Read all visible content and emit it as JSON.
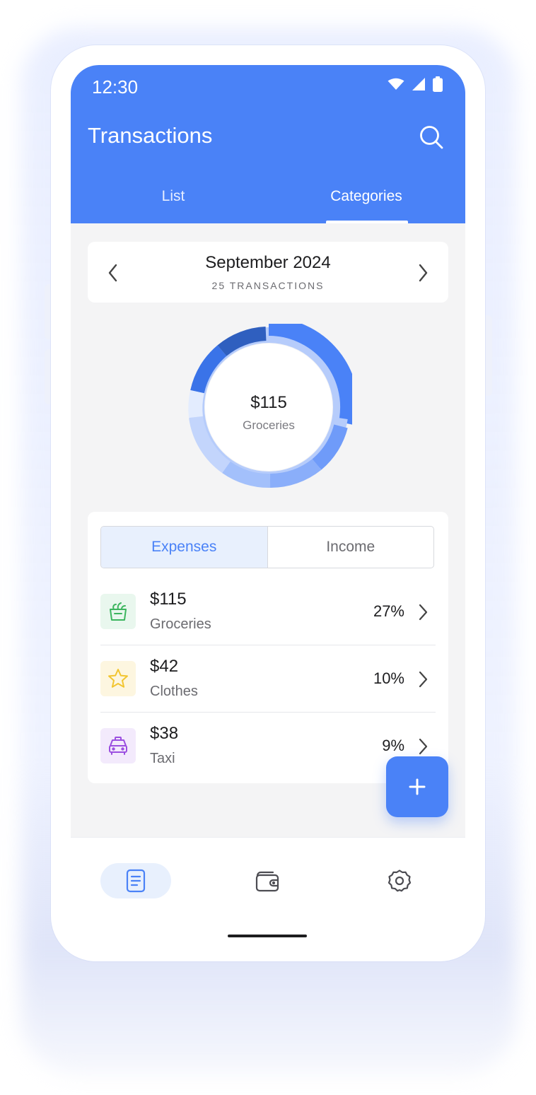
{
  "status_bar": {
    "time": "12:30",
    "icons": [
      "wifi-icon",
      "signal-icon",
      "battery-icon"
    ]
  },
  "app_bar": {
    "title": "Transactions",
    "search_icon": "search-icon"
  },
  "tabs": [
    {
      "label": "List",
      "active": false
    },
    {
      "label": "Categories",
      "active": true
    }
  ],
  "month_selector": {
    "title": "September 2024",
    "subtitle": "25 TRANSACTIONS"
  },
  "donut": {
    "amount": "$115",
    "label": "Groceries"
  },
  "segmented": {
    "expenses": "Expenses",
    "income": "Income",
    "selected": "Expenses"
  },
  "categories": [
    {
      "amount": "$115",
      "name": "Groceries",
      "percent": "27%",
      "icon": "grocery-basket-icon",
      "color": "#3cb55e",
      "bg": "#e9f7ee"
    },
    {
      "amount": "$42",
      "name": "Clothes",
      "percent": "10%",
      "icon": "star-icon",
      "color": "#f2c530",
      "bg": "#fdf6e0"
    },
    {
      "amount": "$38",
      "name": "Taxi",
      "percent": "9%",
      "icon": "taxi-icon",
      "color": "#9b4fe0",
      "bg": "#f3eafc"
    }
  ],
  "fab": {
    "icon": "plus-icon"
  },
  "bottom_nav": [
    {
      "icon": "document-icon",
      "active": true
    },
    {
      "icon": "wallet-icon",
      "active": false
    },
    {
      "icon": "gear-icon",
      "active": false
    }
  ],
  "colors": {
    "primary": "#4a82f7",
    "background": "#f4f4f5"
  }
}
